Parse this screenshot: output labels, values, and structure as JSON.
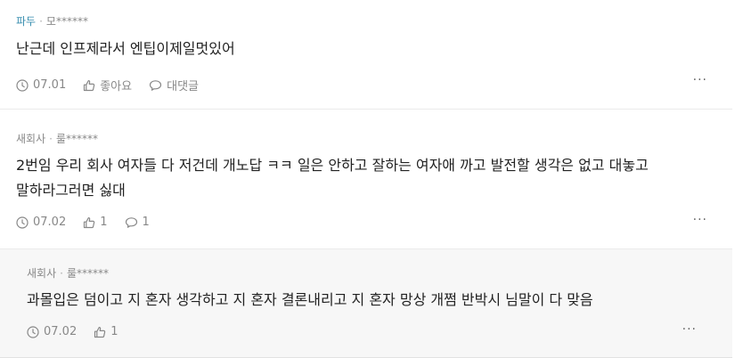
{
  "comments": [
    {
      "company": "파두",
      "author": "모******",
      "text": "난근데 인프제라서 엔팁이제일멋있어",
      "date": "07.01",
      "like_label": "좋아요",
      "reply_label": "대댓글",
      "more": "···"
    },
    {
      "company": "새회사",
      "author": "룰******",
      "text": "2번임 우리 회사 여자들 다 저건데 개노답 ㅋㅋ 일은 안하고 잘하는 여자애 까고 발전할 생각은 없고 대놓고 말하라그러면 싫대",
      "date": "07.02",
      "like_count": "1",
      "reply_count": "1",
      "more": "···"
    },
    {
      "company": "새회사",
      "author": "룰******",
      "text": "과몰입은 덤이고 지 혼자 생각하고 지 혼자 결론내리고 지 혼자 망상 개쩜 반박시 님말이 다 맞음",
      "date": "07.02",
      "like_count": "1",
      "more": "···"
    }
  ],
  "icons": {
    "clock": "clock-icon",
    "like": "thumbs-up-icon",
    "reply": "speech-bubble-icon",
    "more": "more-icon"
  },
  "colors": {
    "company_highlight": "#3a8fb0",
    "meta_text": "#888888",
    "reply_background": "#f7f7f7"
  }
}
